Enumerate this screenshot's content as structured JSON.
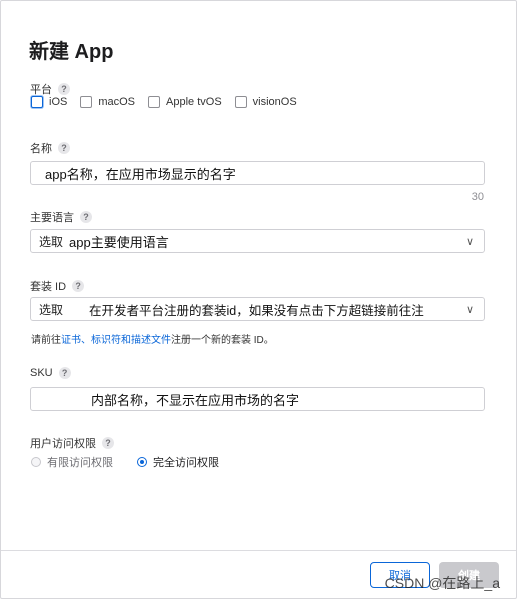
{
  "dialog": {
    "title": "新建 App"
  },
  "platform": {
    "label": "平台",
    "help": "?",
    "options": [
      "iOS",
      "macOS",
      "Apple tvOS",
      "visionOS"
    ]
  },
  "name": {
    "label": "名称",
    "help": "?",
    "value": "app名称，在应用市场显示的名字",
    "counter": "30"
  },
  "language": {
    "label": "主要语言",
    "help": "?",
    "prefix": "选取",
    "value": "app主要使用语言",
    "chevron": "∨"
  },
  "bundle": {
    "label": "套装 ID",
    "help": "?",
    "prefix": "选取",
    "value": "在开发者平台注册的套装id，如果没有点击下方超链接前往注",
    "chevron": "∨",
    "hint_pre": "请前往",
    "hint_link": "证书、标识符和描述文件",
    "hint_post": "注册一个新的套装 ID。"
  },
  "sku": {
    "label": "SKU",
    "help": "?",
    "value": "内部名称，不显示在应用市场的名字"
  },
  "access": {
    "label": "用户访问权限",
    "help": "?",
    "options": [
      "有限访问权限",
      "完全访问权限"
    ]
  },
  "footer": {
    "cancel": "取消",
    "create": "创建",
    "watermark": "CSDN @在路上_a"
  }
}
